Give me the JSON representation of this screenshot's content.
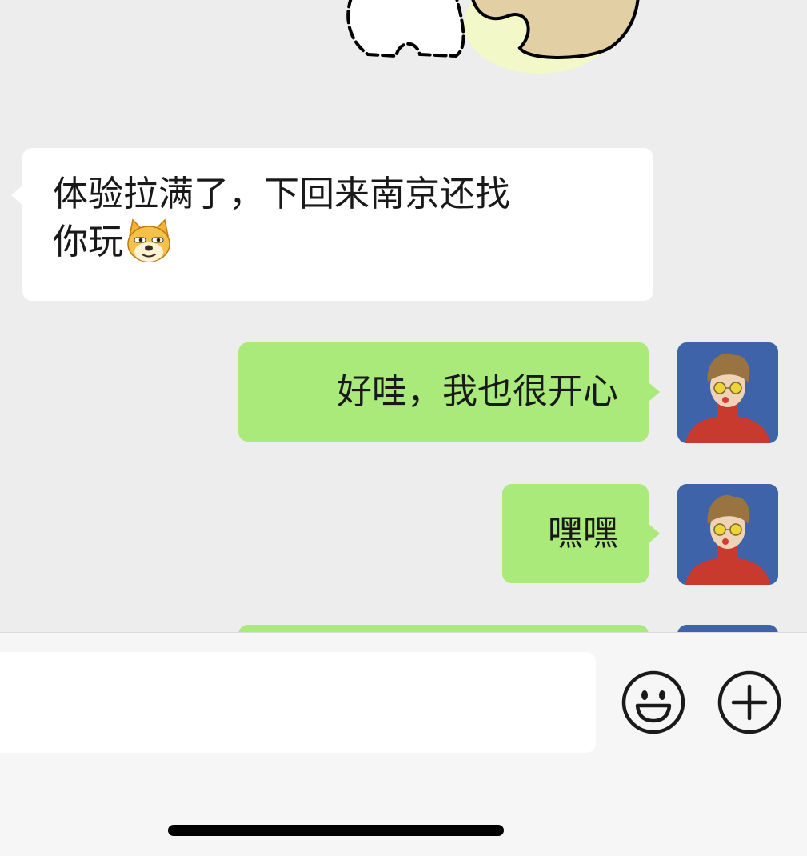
{
  "messages": [
    {
      "direction": "incoming",
      "line1": "体验拉满了，下回来南京还找",
      "line2": "你玩",
      "emoji": "doge-emoji"
    },
    {
      "direction": "outgoing",
      "text": "好哇，我也很开心"
    },
    {
      "direction": "outgoing",
      "text": "嘿嘿"
    },
    {
      "direction": "outgoing",
      "text": ""
    }
  ],
  "input_bar": {
    "placeholder": "",
    "value": "",
    "emoji_icon": "smiley-face-icon",
    "more_icon": "plus-circle-icon"
  },
  "colors": {
    "chat_background": "#ededed",
    "incoming_bubble": "#ffffff",
    "outgoing_bubble": "#a9ea7a",
    "avatar_background": "#3e63a8"
  }
}
